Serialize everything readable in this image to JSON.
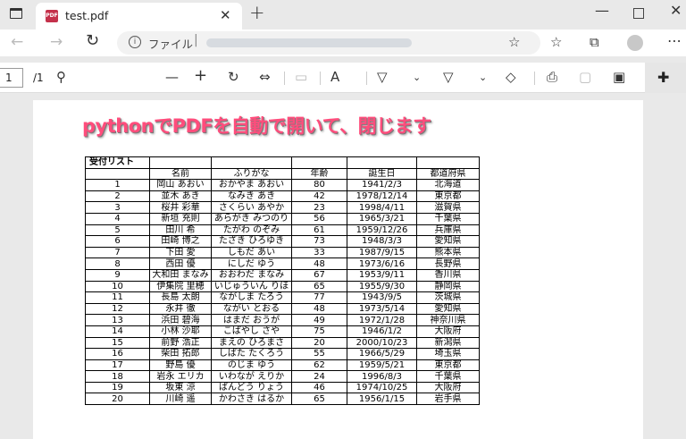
{
  "tab": {
    "title": "test.pdf",
    "pdf_badge": "PDF"
  },
  "address": {
    "scheme_label": "ファイル",
    "separator": "|"
  },
  "pdf_toolbar": {
    "page_current": "1",
    "page_total": "/1"
  },
  "document": {
    "headline": "pythonでPDFを自動で開いて、閉じます",
    "table": {
      "caption": "受付リスト",
      "headers": [
        "",
        "名前",
        "ふりがな",
        "年齢",
        "誕生日",
        "都道府県"
      ],
      "rows": [
        [
          "1",
          "岡山 あおい",
          "おかやま あおい",
          "80",
          "1941/2/3",
          "北海道"
        ],
        [
          "2",
          "並木 あき",
          "なみき あき",
          "42",
          "1978/12/14",
          "東京都"
        ],
        [
          "3",
          "桜井 彩華",
          "さくらい あやか",
          "23",
          "1998/4/11",
          "滋賀県"
        ],
        [
          "4",
          "新垣 充則",
          "あらがき みつのり",
          "56",
          "1965/3/21",
          "千葉県"
        ],
        [
          "5",
          "田川 希",
          "たがわ のぞみ",
          "61",
          "1959/12/26",
          "兵庫県"
        ],
        [
          "6",
          "田崎 博之",
          "たざき ひろゆき",
          "73",
          "1948/3/3",
          "愛知県"
        ],
        [
          "7",
          "下田 愛",
          "しもだ あい",
          "33",
          "1987/9/15",
          "熊本県"
        ],
        [
          "8",
          "西田 優",
          "にしだ ゆう",
          "48",
          "1973/6/16",
          "長野県"
        ],
        [
          "9",
          "大和田 まなみ",
          "おおわだ まなみ",
          "67",
          "1953/9/11",
          "香川県"
        ],
        [
          "10",
          "伊集院 里穂",
          "いじゅういん りほ",
          "65",
          "1955/9/30",
          "静岡県"
        ],
        [
          "11",
          "長島 太朗",
          "ながしま たろう",
          "77",
          "1943/9/5",
          "茨城県"
        ],
        [
          "12",
          "永井 徹",
          "ながい とおる",
          "48",
          "1973/5/14",
          "愛知県"
        ],
        [
          "13",
          "浜田 碧海",
          "はまだ おうが",
          "49",
          "1972/1/28",
          "神奈川県"
        ],
        [
          "14",
          "小林 沙耶",
          "こばやし さや",
          "75",
          "1946/1/2",
          "大阪府"
        ],
        [
          "15",
          "前野 浩正",
          "まえの ひろまさ",
          "20",
          "2000/10/23",
          "新潟県"
        ],
        [
          "16",
          "柴田 拓郎",
          "しばた たくろう",
          "55",
          "1966/5/29",
          "埼玉県"
        ],
        [
          "17",
          "野島 優",
          "のじま ゆう",
          "62",
          "1959/5/21",
          "東京都"
        ],
        [
          "18",
          "岩永 エリカ",
          "いわなが えりか",
          "24",
          "1996/8/3",
          "千葉県"
        ],
        [
          "19",
          "坂東 涼",
          "ばんどう りょう",
          "46",
          "1974/10/25",
          "大阪府"
        ],
        [
          "20",
          "川崎 遥",
          "かわさき はるか",
          "65",
          "1956/1/15",
          "岩手県"
        ]
      ]
    }
  }
}
